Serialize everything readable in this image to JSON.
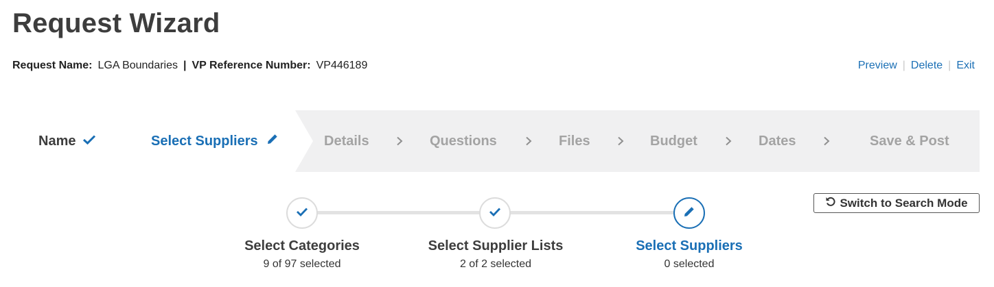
{
  "page": {
    "title": "Request Wizard"
  },
  "meta": {
    "request_name_label": "Request Name:",
    "request_name_value": "LGA Boundaries",
    "separator": "|",
    "vp_ref_label": "VP Reference Number:",
    "vp_ref_value": "VP446189"
  },
  "actions": {
    "preview": "Preview",
    "delete": "Delete",
    "exit": "Exit",
    "divider": "|"
  },
  "wizard": {
    "steps": [
      {
        "label": "Name",
        "state": "done",
        "icon": "check-icon"
      },
      {
        "label": "Select Suppliers",
        "state": "current",
        "icon": "pencil-icon"
      },
      {
        "label": "Details",
        "state": "future"
      },
      {
        "label": "Questions",
        "state": "future"
      },
      {
        "label": "Files",
        "state": "future"
      },
      {
        "label": "Budget",
        "state": "future"
      },
      {
        "label": "Dates",
        "state": "future"
      },
      {
        "label": "Save & Post",
        "state": "future"
      }
    ]
  },
  "substeps": [
    {
      "label": "Select Categories",
      "count": "9 of 97 selected",
      "state": "done",
      "icon": "check-icon"
    },
    {
      "label": "Select Supplier Lists",
      "count": "2 of 2 selected",
      "state": "done",
      "icon": "check-icon"
    },
    {
      "label": "Select Suppliers",
      "count": "0 selected",
      "state": "current",
      "icon": "pencil-icon"
    }
  ],
  "switch_button": {
    "label": "Switch to Search Mode",
    "icon": "undo-icon"
  },
  "colors": {
    "accent": "#1a6fb5",
    "text": "#3d3d3d",
    "muted": "#a3a3a3",
    "stepbar_bg": "#f0f0f1"
  }
}
